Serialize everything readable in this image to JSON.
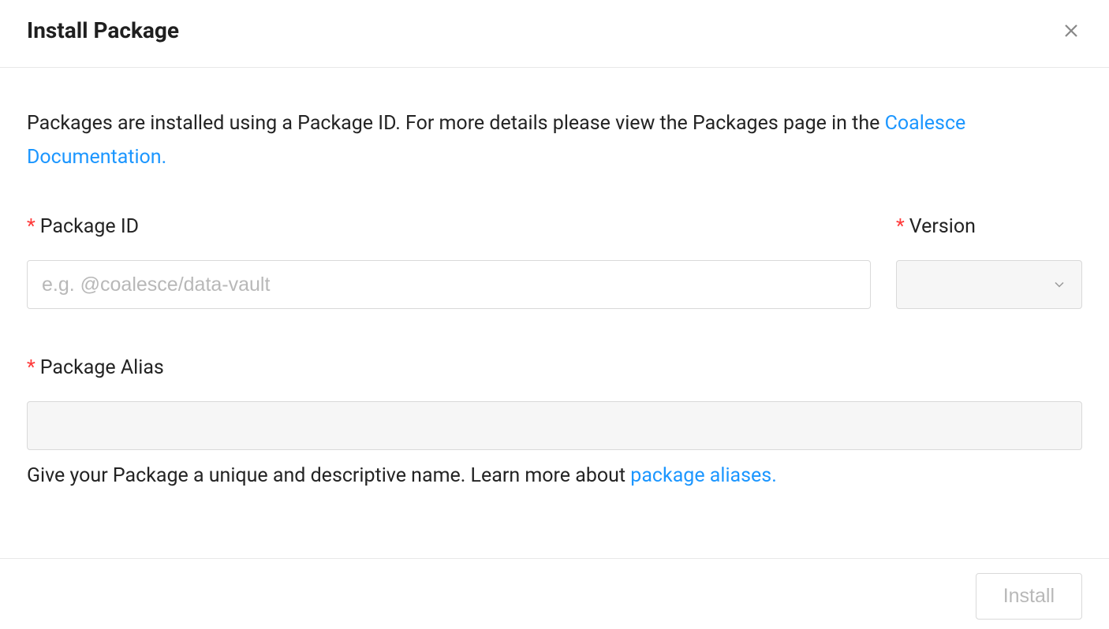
{
  "dialog": {
    "title": "Install Package",
    "intro_text": "Packages are installed using a Package ID. For more details please view the Packages page in the ",
    "doc_link_text": "Coalesce Documentation.",
    "package_id": {
      "label": "Package ID",
      "placeholder": "e.g. @coalesce/data-vault",
      "value": ""
    },
    "version": {
      "label": "Version",
      "value": ""
    },
    "alias": {
      "label": "Package Alias",
      "value": "",
      "helper_prefix": "Give your Package a unique and descriptive name. Learn more about ",
      "helper_link": "package aliases."
    },
    "install_label": "Install"
  }
}
